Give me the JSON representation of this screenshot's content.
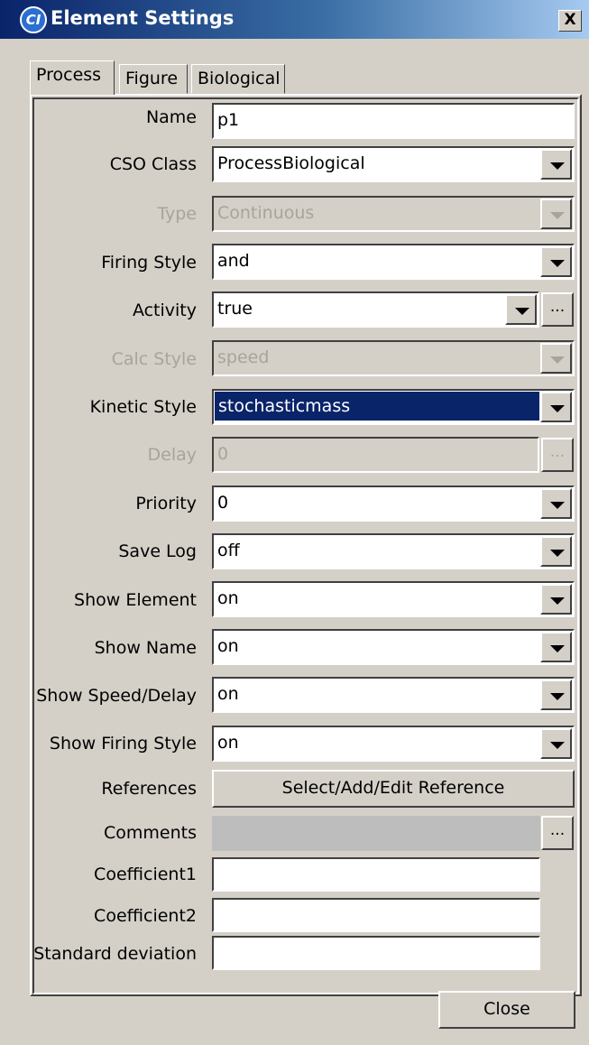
{
  "window": {
    "title": "Element Settings",
    "icon": "ci-app-icon",
    "close_label": "X"
  },
  "tabs": [
    {
      "label": "Process",
      "active": true
    },
    {
      "label": "Figure",
      "active": false
    },
    {
      "label": "Biological",
      "active": false
    }
  ],
  "form": {
    "name": {
      "label": "Name",
      "value": "p1"
    },
    "cso_class": {
      "label": "CSO Class",
      "value": "ProcessBiological"
    },
    "type": {
      "label": "Type",
      "value": "Continuous",
      "disabled": true
    },
    "firing_style": {
      "label": "Firing Style",
      "value": "and"
    },
    "activity": {
      "label": "Activity",
      "value": "true",
      "ellipsis": "..."
    },
    "calc_style": {
      "label": "Calc Style",
      "value": "speed",
      "disabled": true
    },
    "kinetic_style": {
      "label": "Kinetic Style",
      "value": "stochasticmass",
      "selected": true
    },
    "delay": {
      "label": "Delay",
      "value": "0",
      "disabled": true,
      "ellipsis": "..."
    },
    "priority": {
      "label": "Priority",
      "value": "0"
    },
    "save_log": {
      "label": "Save Log",
      "value": "off"
    },
    "show_element": {
      "label": "Show Element",
      "value": "on"
    },
    "show_name": {
      "label": "Show Name",
      "value": "on"
    },
    "show_speed_delay": {
      "label": "Show Speed/Delay",
      "value": "on"
    },
    "show_firing_style": {
      "label": "Show Firing Style",
      "value": "on"
    },
    "references": {
      "label": "References",
      "button": "Select/Add/Edit Reference"
    },
    "comments": {
      "label": "Comments",
      "ellipsis": "..."
    },
    "coefficient1": {
      "label": "Coefficient1",
      "value": ""
    },
    "coefficient2": {
      "label": "Coefficient2",
      "value": ""
    },
    "standard_deviation": {
      "label": "Standard deviation",
      "value": ""
    }
  },
  "footer": {
    "close_label": "Close"
  },
  "colors": {
    "selection": "#0a246a",
    "dialog_bg": "#d4d0c8",
    "disabled_text": "#a8a49c"
  }
}
